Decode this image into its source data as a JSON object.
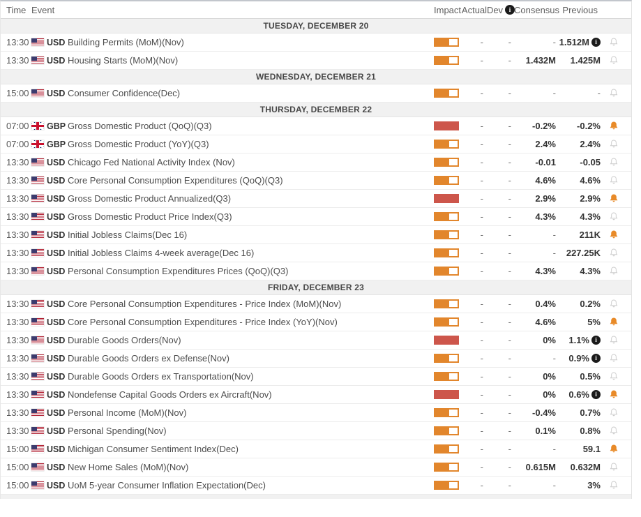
{
  "colors": {
    "impact_medium": "#e2862c",
    "impact_high": "#cd564b",
    "alert_active": "#e88a28",
    "alert_inactive": "#cccccc",
    "info_badge": "#1b1b1b",
    "date_row_bg": "#f1f1f1"
  },
  "header": {
    "time": "Time",
    "event": "Event",
    "impact": "Impact",
    "actual": "Actual",
    "dev": "Dev",
    "dev_info": "i",
    "consensus": "Consensus",
    "previous": "Previous"
  },
  "info_glyph": "i",
  "days": [
    {
      "date": "TUESDAY, DECEMBER 20",
      "events": [
        {
          "time": "13:30",
          "currency": "USD",
          "flag": "us",
          "name": "Building Permits (MoM)(Nov)",
          "impact": "medium",
          "actual": "-",
          "dev": "-",
          "consensus": "-",
          "previous": "1.512M",
          "previous_info": true,
          "alert": "off"
        },
        {
          "time": "13:30",
          "currency": "USD",
          "flag": "us",
          "name": "Housing Starts (MoM)(Nov)",
          "impact": "medium",
          "actual": "-",
          "dev": "-",
          "consensus": "1.432M",
          "previous": "1.425M",
          "previous_info": false,
          "alert": "off"
        }
      ]
    },
    {
      "date": "WEDNESDAY, DECEMBER 21",
      "events": [
        {
          "time": "15:00",
          "currency": "USD",
          "flag": "us",
          "name": "Consumer Confidence(Dec)",
          "impact": "medium",
          "actual": "-",
          "dev": "-",
          "consensus": "-",
          "previous": "-",
          "previous_info": false,
          "alert": "off"
        }
      ]
    },
    {
      "date": "THURSDAY, DECEMBER 22",
      "events": [
        {
          "time": "07:00",
          "currency": "GBP",
          "flag": "gb",
          "name": "Gross Domestic Product (QoQ)(Q3)",
          "impact": "high",
          "actual": "-",
          "dev": "-",
          "consensus": "-0.2%",
          "previous": "-0.2%",
          "previous_info": false,
          "alert": "on"
        },
        {
          "time": "07:00",
          "currency": "GBP",
          "flag": "gb",
          "name": "Gross Domestic Product (YoY)(Q3)",
          "impact": "medium",
          "actual": "-",
          "dev": "-",
          "consensus": "2.4%",
          "previous": "2.4%",
          "previous_info": false,
          "alert": "off"
        },
        {
          "time": "13:30",
          "currency": "USD",
          "flag": "us",
          "name": "Chicago Fed National Activity Index (Nov)",
          "impact": "medium",
          "actual": "-",
          "dev": "-",
          "consensus": "-0.01",
          "previous": "-0.05",
          "previous_info": false,
          "alert": "off"
        },
        {
          "time": "13:30",
          "currency": "USD",
          "flag": "us",
          "name": "Core Personal Consumption Expenditures (QoQ)(Q3)",
          "impact": "medium",
          "actual": "-",
          "dev": "-",
          "consensus": "4.6%",
          "previous": "4.6%",
          "previous_info": false,
          "alert": "off"
        },
        {
          "time": "13:30",
          "currency": "USD",
          "flag": "us",
          "name": "Gross Domestic Product Annualized(Q3)",
          "impact": "high",
          "actual": "-",
          "dev": "-",
          "consensus": "2.9%",
          "previous": "2.9%",
          "previous_info": false,
          "alert": "on"
        },
        {
          "time": "13:30",
          "currency": "USD",
          "flag": "us",
          "name": "Gross Domestic Product Price Index(Q3)",
          "impact": "medium",
          "actual": "-",
          "dev": "-",
          "consensus": "4.3%",
          "previous": "4.3%",
          "previous_info": false,
          "alert": "off"
        },
        {
          "time": "13:30",
          "currency": "USD",
          "flag": "us",
          "name": "Initial Jobless Claims(Dec 16)",
          "impact": "medium",
          "actual": "-",
          "dev": "-",
          "consensus": "-",
          "previous": "211K",
          "previous_info": false,
          "alert": "on"
        },
        {
          "time": "13:30",
          "currency": "USD",
          "flag": "us",
          "name": "Initial Jobless Claims 4-week average(Dec 16)",
          "impact": "medium",
          "actual": "-",
          "dev": "-",
          "consensus": "-",
          "previous": "227.25K",
          "previous_info": false,
          "alert": "off"
        },
        {
          "time": "13:30",
          "currency": "USD",
          "flag": "us",
          "name": "Personal Consumption Expenditures Prices (QoQ)(Q3)",
          "impact": "medium",
          "actual": "-",
          "dev": "-",
          "consensus": "4.3%",
          "previous": "4.3%",
          "previous_info": false,
          "alert": "off"
        }
      ]
    },
    {
      "date": "FRIDAY, DECEMBER 23",
      "events": [
        {
          "time": "13:30",
          "currency": "USD",
          "flag": "us",
          "name": "Core Personal Consumption Expenditures - Price Index (MoM)(Nov)",
          "impact": "medium",
          "actual": "-",
          "dev": "-",
          "consensus": "0.4%",
          "previous": "0.2%",
          "previous_info": false,
          "alert": "off"
        },
        {
          "time": "13:30",
          "currency": "USD",
          "flag": "us",
          "name": "Core Personal Consumption Expenditures - Price Index (YoY)(Nov)",
          "impact": "medium",
          "actual": "-",
          "dev": "-",
          "consensus": "4.6%",
          "previous": "5%",
          "previous_info": false,
          "alert": "on"
        },
        {
          "time": "13:30",
          "currency": "USD",
          "flag": "us",
          "name": "Durable Goods Orders(Nov)",
          "impact": "high",
          "actual": "-",
          "dev": "-",
          "consensus": "0%",
          "previous": "1.1%",
          "previous_info": true,
          "alert": "off"
        },
        {
          "time": "13:30",
          "currency": "USD",
          "flag": "us",
          "name": "Durable Goods Orders ex Defense(Nov)",
          "impact": "medium",
          "actual": "-",
          "dev": "-",
          "consensus": "-",
          "previous": "0.9%",
          "previous_info": true,
          "alert": "off"
        },
        {
          "time": "13:30",
          "currency": "USD",
          "flag": "us",
          "name": "Durable Goods Orders ex Transportation(Nov)",
          "impact": "medium",
          "actual": "-",
          "dev": "-",
          "consensus": "0%",
          "previous": "0.5%",
          "previous_info": false,
          "alert": "off"
        },
        {
          "time": "13:30",
          "currency": "USD",
          "flag": "us",
          "name": "Nondefense Capital Goods Orders ex Aircraft(Nov)",
          "impact": "high",
          "actual": "-",
          "dev": "-",
          "consensus": "0%",
          "previous": "0.6%",
          "previous_info": true,
          "alert": "on"
        },
        {
          "time": "13:30",
          "currency": "USD",
          "flag": "us",
          "name": "Personal Income (MoM)(Nov)",
          "impact": "medium",
          "actual": "-",
          "dev": "-",
          "consensus": "-0.4%",
          "previous": "0.7%",
          "previous_info": false,
          "alert": "off"
        },
        {
          "time": "13:30",
          "currency": "USD",
          "flag": "us",
          "name": "Personal Spending(Nov)",
          "impact": "medium",
          "actual": "-",
          "dev": "-",
          "consensus": "0.1%",
          "previous": "0.8%",
          "previous_info": false,
          "alert": "off"
        },
        {
          "time": "15:00",
          "currency": "USD",
          "flag": "us",
          "name": "Michigan Consumer Sentiment Index(Dec)",
          "impact": "medium",
          "actual": "-",
          "dev": "-",
          "consensus": "-",
          "previous": "59.1",
          "previous_info": false,
          "alert": "on"
        },
        {
          "time": "15:00",
          "currency": "USD",
          "flag": "us",
          "name": "New Home Sales (MoM)(Nov)",
          "impact": "medium",
          "actual": "-",
          "dev": "-",
          "consensus": "0.615M",
          "previous": "0.632M",
          "previous_info": false,
          "alert": "off"
        },
        {
          "time": "15:00",
          "currency": "USD",
          "flag": "us",
          "name": "UoM 5-year Consumer Inflation Expectation(Dec)",
          "impact": "medium",
          "actual": "-",
          "dev": "-",
          "consensus": "-",
          "previous": "3%",
          "previous_info": false,
          "alert": "off"
        }
      ]
    }
  ]
}
